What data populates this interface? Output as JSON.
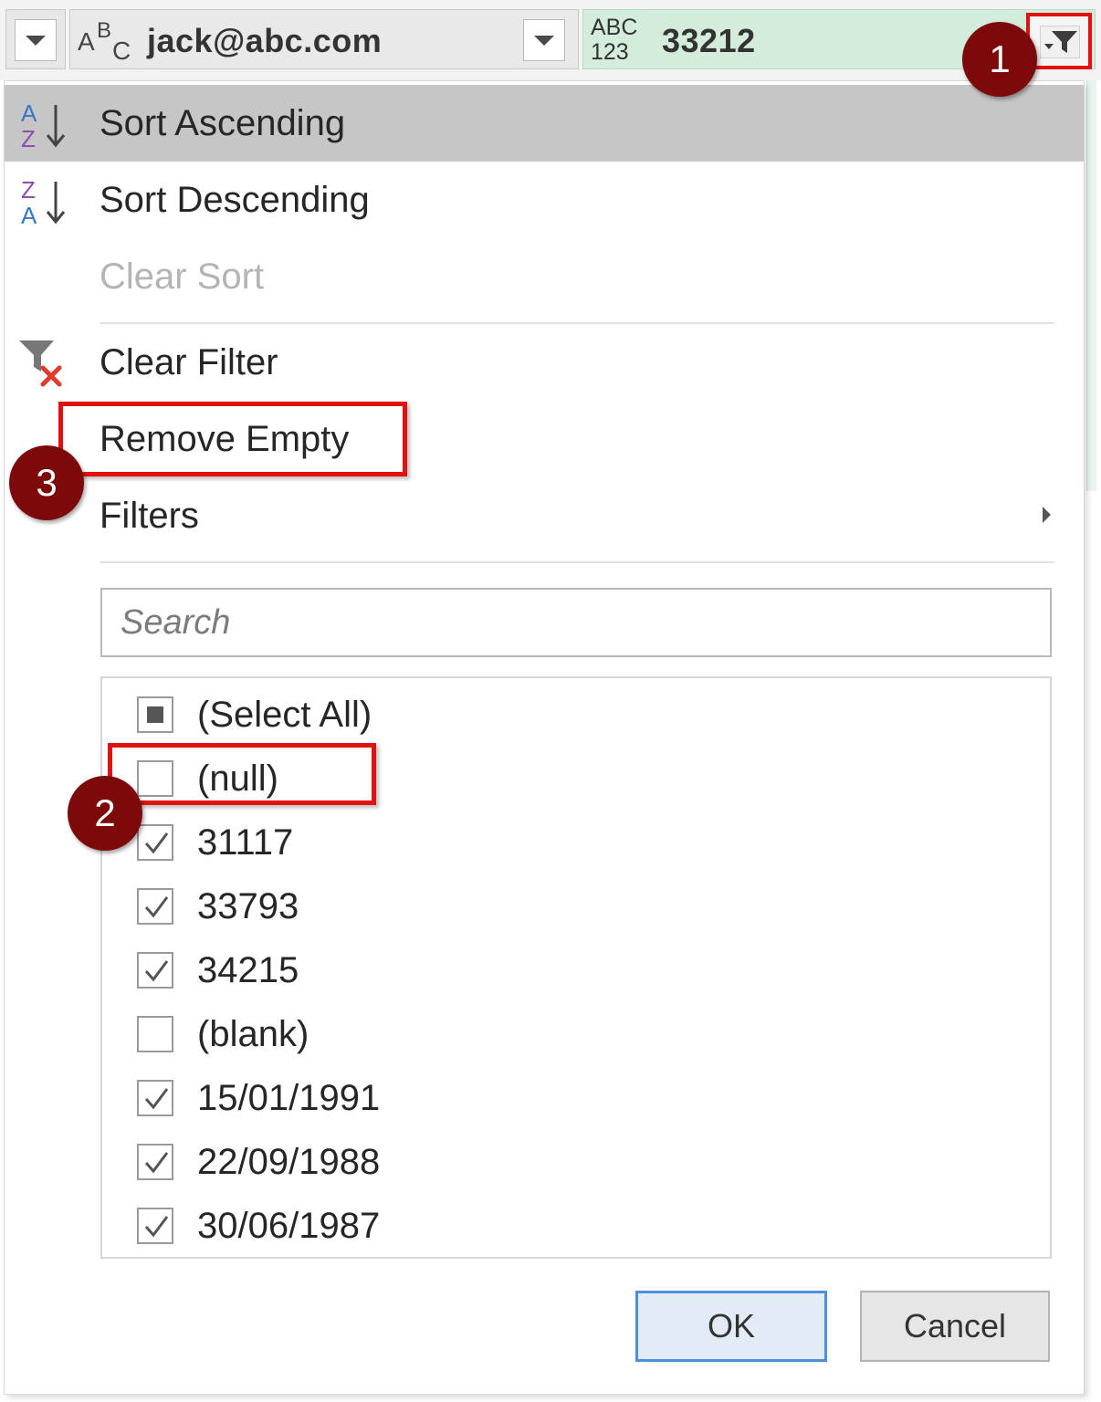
{
  "header": {
    "email_value": "jack@abc.com",
    "email_type_icon": "abc-type-icon",
    "zip_value": "33212",
    "zip_type_abc": "ABC",
    "zip_type_123": "123",
    "filter_icon": "filter-dropdown-icon"
  },
  "menu": {
    "sort_ascending": "Sort Ascending",
    "sort_descending": "Sort Descending",
    "clear_sort": "Clear Sort",
    "clear_filter": "Clear Filter",
    "remove_empty": "Remove Empty",
    "filters": "Filters"
  },
  "search": {
    "placeholder": "Search"
  },
  "list": {
    "items": [
      {
        "label": "(Select All)",
        "state": "indeterminate"
      },
      {
        "label": "(null)",
        "state": "unchecked"
      },
      {
        "label": "31117",
        "state": "checked"
      },
      {
        "label": "33793",
        "state": "checked"
      },
      {
        "label": "34215",
        "state": "checked"
      },
      {
        "label": "(blank)",
        "state": "unchecked"
      },
      {
        "label": "15/01/1991",
        "state": "checked"
      },
      {
        "label": "22/09/1988",
        "state": "checked"
      },
      {
        "label": "30/06/1987",
        "state": "checked"
      }
    ]
  },
  "buttons": {
    "ok": "OK",
    "cancel": "Cancel"
  },
  "annotations": {
    "step1": "1",
    "step2": "2",
    "step3": "3"
  },
  "colors": {
    "highlight": "#e01111",
    "badge": "#7d0a0a",
    "ok_border": "#4c90d9",
    "zip_header": "#d4ecdc"
  }
}
